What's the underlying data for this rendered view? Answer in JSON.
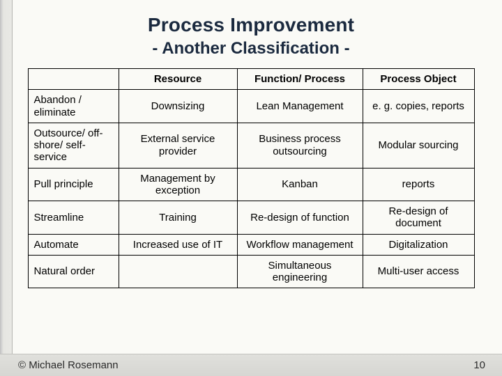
{
  "title": {
    "main": "Process Improvement",
    "sub": "- Another Classification -"
  },
  "headers": [
    "Resource",
    "Function/ Process",
    "Process Object"
  ],
  "rows": [
    {
      "label": "Abandon / eliminate",
      "cells": [
        "Downsizing",
        "Lean Management",
        "e. g. copies, reports"
      ]
    },
    {
      "label": "Outsource/ off-shore/ self-service",
      "cells": [
        "External service provider",
        "Business process outsourcing",
        "Modular sourcing"
      ]
    },
    {
      "label": "Pull principle",
      "cells": [
        "Management by exception",
        "Kanban",
        "reports"
      ]
    },
    {
      "label": "Streamline",
      "cells": [
        "Training",
        "Re-design of function",
        "Re-design of document"
      ]
    },
    {
      "label": "Automate",
      "cells": [
        "Increased use of IT",
        "Workflow management",
        "Digitalization"
      ]
    },
    {
      "label": "Natural order",
      "cells": [
        "",
        "Simultaneous engineering",
        "Multi-user access"
      ]
    }
  ],
  "footer": {
    "copyright": "© Michael Rosemann",
    "page_number": "10"
  }
}
